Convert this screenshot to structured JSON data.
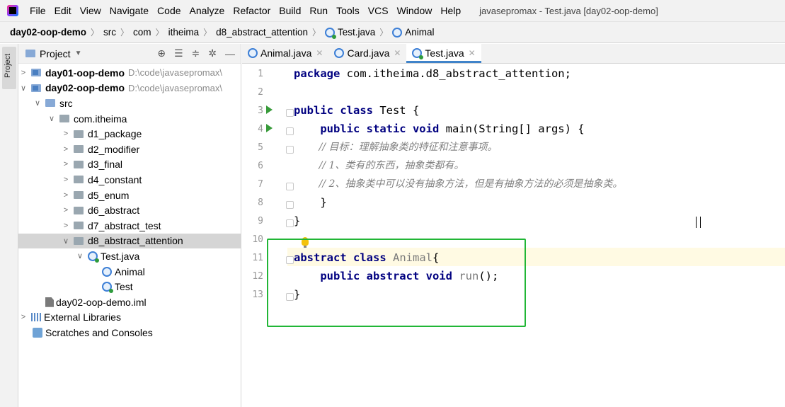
{
  "menubar": {
    "items": [
      "File",
      "Edit",
      "View",
      "Navigate",
      "Code",
      "Analyze",
      "Refactor",
      "Build",
      "Run",
      "Tools",
      "VCS",
      "Window",
      "Help"
    ],
    "title": "javasepromax - Test.java [day02-oop-demo]"
  },
  "breadcrumb": {
    "items": [
      "day02-oop-demo",
      "src",
      "com",
      "itheima",
      "d8_abstract_attention",
      "Test.java",
      "Animal"
    ]
  },
  "leftstrip": {
    "tab_label": "Project"
  },
  "project": {
    "header_label": "Project",
    "tree": [
      {
        "label": "day01-oop-demo",
        "path": "D:\\code\\javasepromax\\"
      },
      {
        "label": "day02-oop-demo",
        "path": "D:\\code\\javasepromax\\"
      },
      {
        "label": "src"
      },
      {
        "label": "com.itheima"
      },
      {
        "label": "d1_package"
      },
      {
        "label": "d2_modifier"
      },
      {
        "label": "d3_final"
      },
      {
        "label": "d4_constant"
      },
      {
        "label": "d5_enum"
      },
      {
        "label": "d6_abstract"
      },
      {
        "label": "d7_abstract_test"
      },
      {
        "label": "d8_abstract_attention"
      },
      {
        "label": "Test.java"
      },
      {
        "label": "Animal"
      },
      {
        "label": "Test"
      },
      {
        "label": "day02-oop-demo.iml"
      },
      {
        "label": "External Libraries"
      },
      {
        "label": "Scratches and Consoles"
      }
    ]
  },
  "tabs": [
    {
      "label": "Animal.java"
    },
    {
      "label": "Card.java"
    },
    {
      "label": "Test.java"
    }
  ],
  "editor": {
    "line_numbers": [
      "1",
      "2",
      "3",
      "4",
      "5",
      "6",
      "7",
      "8",
      "9",
      "10",
      "11",
      "12",
      "13"
    ],
    "code": {
      "l1_kw": "package",
      "l1_rest": " com.itheima.d8_abstract_attention;",
      "l3_kw": "public class",
      "l3_rest": " Test {",
      "l4_indent": "    ",
      "l4_kw": "public static void",
      "l4_rest": " main(String[] args) {",
      "l5": "        // 目标：理解抽象类的特征和注意事项。",
      "l6": "        // 1、类有的东西，抽象类都有。",
      "l7": "        // 2、抽象类中可以没有抽象方法，但是有抽象方法的必须是抽象类。",
      "l8": "    }",
      "l9": "}",
      "l11_kw": "abstract class",
      "l11_name": " Animal",
      "l11_rest": "{",
      "l12_indent": "    ",
      "l12_kw": "public abstract void",
      "l12_name": " run",
      "l12_rest": "();",
      "l13": "}"
    }
  }
}
